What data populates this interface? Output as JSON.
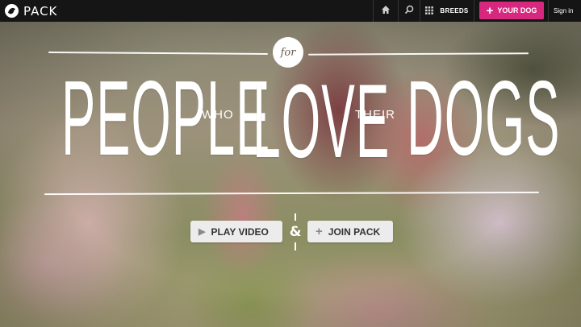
{
  "nav": {
    "brand": "PACK",
    "breeds_label": "BREEDS",
    "your_dog_label": "YOUR DOG",
    "signin_label": "Sign in"
  },
  "hero": {
    "for": "for",
    "word_people": "PEOPLE",
    "word_who": "WHO",
    "word_love": "LOVE",
    "word_their": "THEIR",
    "word_dogs": "DOGS",
    "play_label": "PLAY VIDEO",
    "ampersand": "&",
    "join_label": "JOIN PACK"
  },
  "colors": {
    "topbar": "#151515",
    "accent": "#d8277e",
    "button_bg": "#ececec"
  },
  "icons": [
    "pack-logo-icon",
    "home-icon",
    "search-icon",
    "grid-icon",
    "plus-icon",
    "play-icon"
  ]
}
